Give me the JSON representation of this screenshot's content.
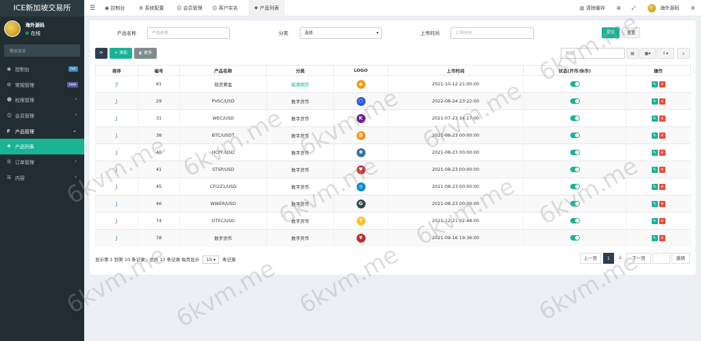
{
  "app": {
    "title": "ICE新加坡交易所"
  },
  "user": {
    "name": "海外源码",
    "status": "在线"
  },
  "sidebar": {
    "search_placeholder": "搜索菜单",
    "items": [
      {
        "label": "控制台",
        "icon": "dashboard-icon",
        "badge": "hot",
        "badge_color": "#3c8dbc"
      },
      {
        "label": "常规管理",
        "icon": "cogs-icon",
        "badge": "new",
        "badge_color": "#605ca8"
      },
      {
        "label": "权限管理",
        "icon": "group-icon",
        "arrow": "‹"
      },
      {
        "label": "会员管理",
        "icon": "user-circle-icon",
        "arrow": "‹"
      },
      {
        "label": "产品管理",
        "icon": "product-icon",
        "arrow": "⌄"
      },
      {
        "label": "产品列表",
        "icon": "cubes-icon",
        "active": true
      },
      {
        "label": "订单管理",
        "icon": "list-icon",
        "arrow": "‹"
      },
      {
        "label": "内容",
        "icon": "list-icon",
        "arrow": "‹"
      }
    ]
  },
  "topbar": {
    "tabs": [
      {
        "label": "控制台",
        "icon": "dashboard-icon"
      },
      {
        "label": "系统配置",
        "icon": "gear-icon"
      },
      {
        "label": "会员管理",
        "icon": "user-icon"
      },
      {
        "label": "客户实名",
        "icon": "user-icon"
      },
      {
        "label": "产品列表",
        "icon": "cubes-icon"
      }
    ],
    "clear_cache": "清除缓存",
    "user_name": "海外源码"
  },
  "filters": {
    "name_label": "产品名称",
    "name_placeholder": "产品名称",
    "category_label": "分类",
    "category_value": "选择",
    "date_label": "上市时间",
    "date_placeholder": "上市时间",
    "submit": "提交",
    "reset": "重置"
  },
  "toolbar": {
    "add": "+ 添加",
    "more": "更多",
    "search_placeholder": "搜索"
  },
  "table": {
    "headers": [
      "排序",
      "编号",
      "产品名称",
      "分类",
      "LOGO",
      "上市时间",
      "状态(开市/休市)",
      "操作"
    ],
    "rows": [
      {
        "sort": "0",
        "id": "81",
        "name": "现货黄金",
        "category": "能源期货",
        "category_link": true,
        "logo_color": "#f39c12",
        "logo_char": "◆",
        "date": "2021-10-12 21:00:00"
      },
      {
        "sort": "1",
        "id": "29",
        "name": "PVSC/USD",
        "category": "数字货币",
        "logo_color": "#2a5ada",
        "logo_char": "⬡",
        "date": "2022-08-24 23:22:00"
      },
      {
        "sort": "1",
        "id": "31",
        "name": "WEC/USD",
        "category": "数字货币",
        "logo_color": "#6a1b9a",
        "logo_char": "K",
        "date": "2021-07-23 14:17:00"
      },
      {
        "sort": "1",
        "id": "38",
        "name": "BTC/USDT",
        "category": "数字货币",
        "logo_color": "#f7931a",
        "logo_char": "₿",
        "date": "2021-08-23 00:00:00"
      },
      {
        "sort": "1",
        "id": "40",
        "name": "HCPF/USD",
        "category": "数字货币",
        "logo_color": "#3a6ea5",
        "logo_char": "✺",
        "date": "2021-08-23 00:00:00"
      },
      {
        "sort": "1",
        "id": "41",
        "name": "STSP/USD",
        "category": "数字货币",
        "logo_color": "#d32f2f",
        "logo_char": "♥",
        "date": "2021-08-23 00:00:00"
      },
      {
        "sort": "1",
        "id": "45",
        "name": "CFI2Z1/USD",
        "category": "数字货币",
        "logo_color": "#0288d1",
        "logo_char": "◎",
        "date": "2021-08-23 00:00:00"
      },
      {
        "sort": "1",
        "id": "46",
        "name": "WWER/USD",
        "category": "数字货币",
        "logo_color": "#37474f",
        "logo_char": "G",
        "date": "2021-08-23 00:00:00"
      },
      {
        "sort": "1",
        "id": "74",
        "name": "OTEC/USD",
        "category": "数字货币",
        "logo_color": "#fbc02d",
        "logo_char": "T",
        "date": "2021-12-21 02:48:00"
      },
      {
        "sort": "1",
        "id": "78",
        "name": "数字货币",
        "category": "数字货币",
        "logo_color": "#c62828",
        "logo_char": "¥",
        "date": "2021-09-16 19:36:00"
      }
    ]
  },
  "footer": {
    "summary_prefix": "显示第 1 到第 10 条记录，总共 17 条记录 每页显示",
    "page_size": "10",
    "summary_suffix": "条记录",
    "prev": "上一页",
    "pages": [
      "1",
      "2"
    ],
    "next": "下一页",
    "goto": "跳转"
  },
  "watermark": "6kvm.me",
  "colors": {
    "accent": "#1ab394",
    "sidebar": "#222d32",
    "primary": "#2c3e50"
  }
}
